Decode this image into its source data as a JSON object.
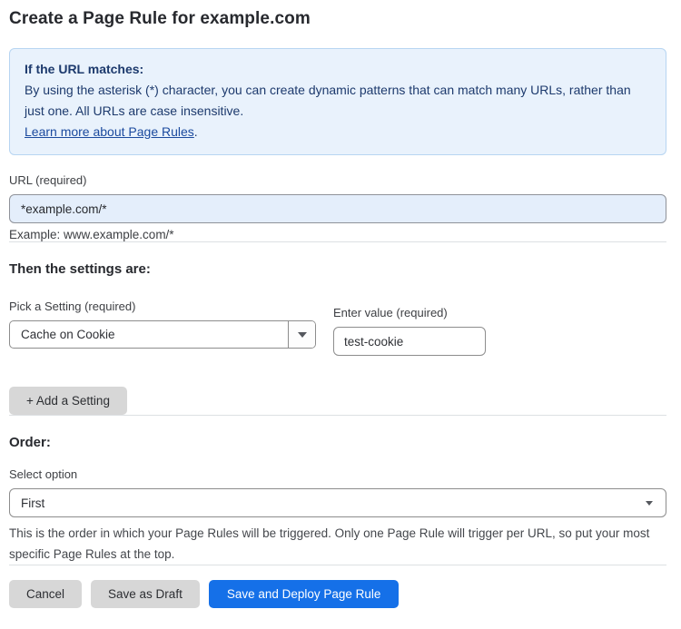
{
  "page": {
    "title": "Create a Page Rule for example.com"
  },
  "info_box": {
    "heading": "If the URL matches:",
    "body": "By using the asterisk (*) character, you can create dynamic patterns that can match many URLs, rather than just one. All URLs are case insensitive.",
    "link": "Learn more about Page Rules",
    "link_suffix": "."
  },
  "url_field": {
    "label": "URL (required)",
    "value": "*example.com/*",
    "hint": "Example: www.example.com/*"
  },
  "settings": {
    "heading": "Then the settings are:",
    "setting_select": {
      "label": "Pick a Setting (required)",
      "value": "Cache on Cookie"
    },
    "value_input": {
      "label": "Enter value (required)",
      "value": "test-cookie"
    },
    "add_button": "+ Add a Setting"
  },
  "order": {
    "heading": "Order:",
    "select_label": "Select option",
    "select_value": "First",
    "help": "This is the order in which your Page Rules will be triggered. Only one Page Rule will trigger per URL, so put your most specific Page Rules at the top."
  },
  "footer": {
    "cancel": "Cancel",
    "save_draft": "Save as Draft",
    "save_deploy": "Save and Deploy Page Rule"
  },
  "colors": {
    "primary_blue": "#1570e8",
    "info_bg": "#e9f2fc",
    "info_border": "#b7d5f2",
    "info_text": "#1d3a6d",
    "url_input_bg": "#e4eefb",
    "gray_button_bg": "#d7d7d7"
  }
}
